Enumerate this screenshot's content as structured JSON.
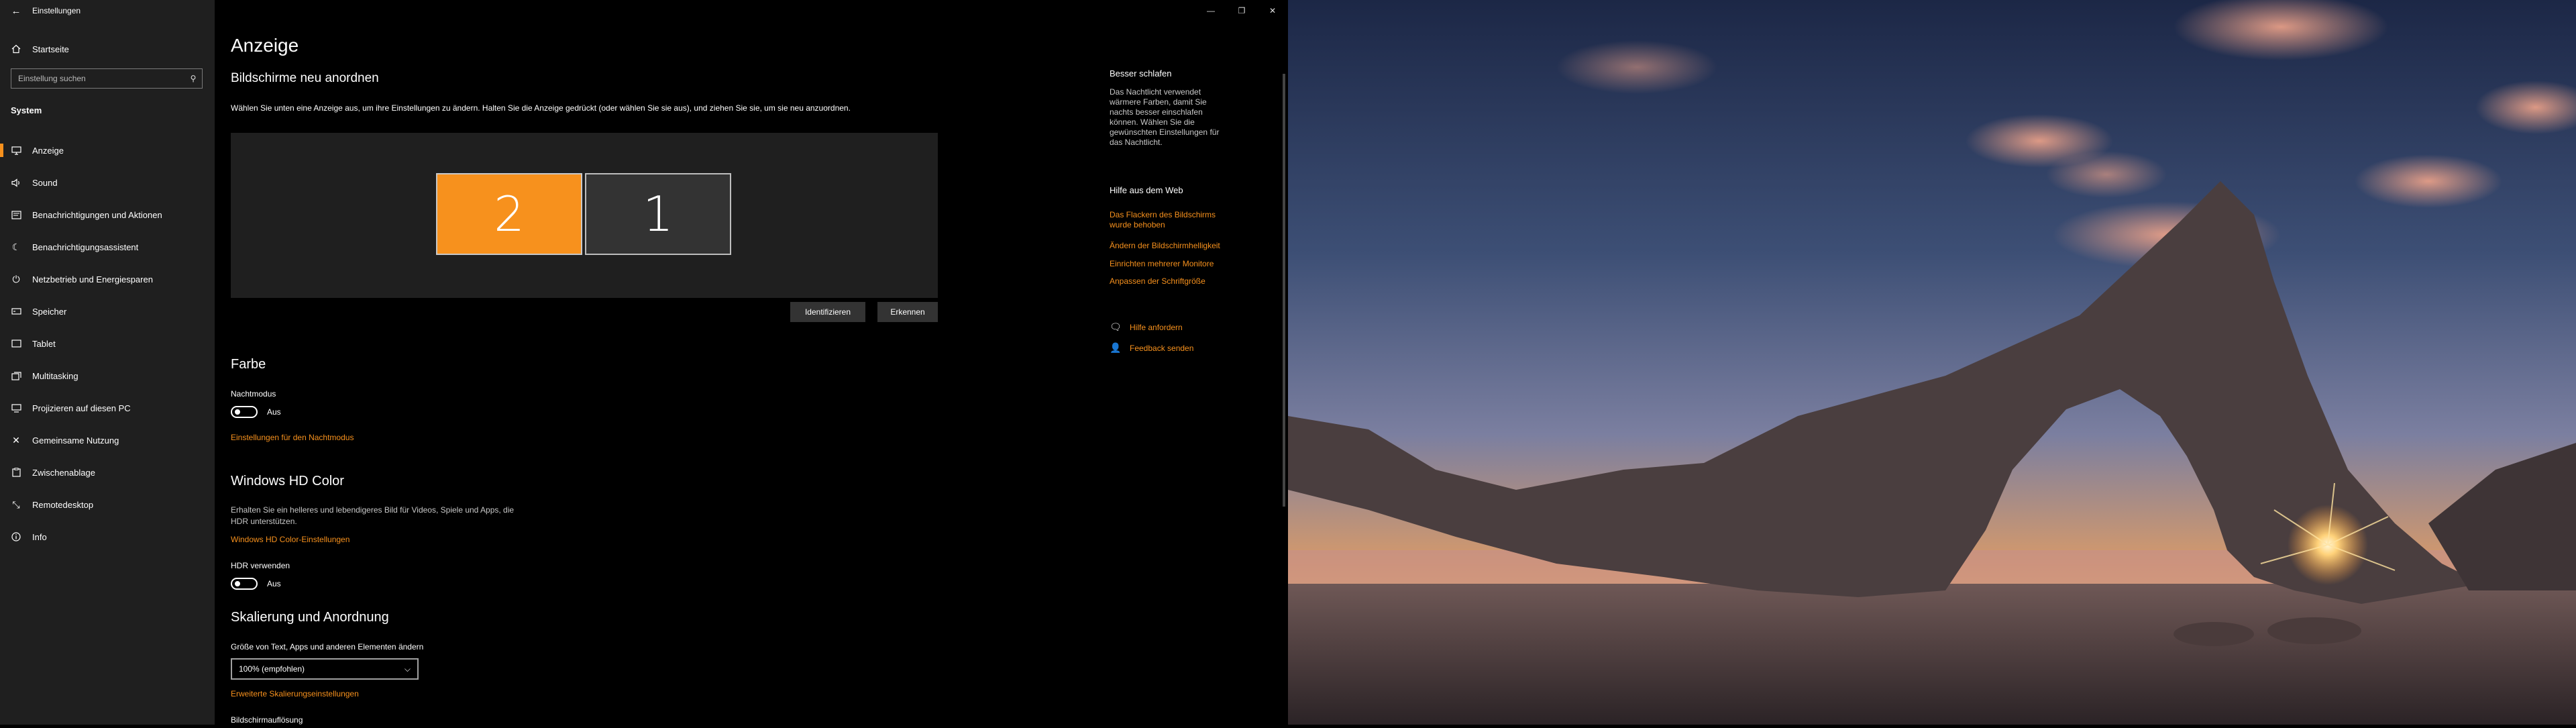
{
  "window": {
    "title": "Einstellungen",
    "controls": {
      "minimize": "—",
      "maximize": "❐",
      "close": "✕"
    }
  },
  "sidebar": {
    "home_label": "Startseite",
    "search_placeholder": "Einstellung suchen",
    "section": "System",
    "items": [
      {
        "label": "Anzeige",
        "icon": "monitor-icon",
        "selected": true
      },
      {
        "label": "Sound",
        "icon": "speaker-icon"
      },
      {
        "label": "Benachrichtigungen und Aktionen",
        "icon": "notification-icon"
      },
      {
        "label": "Benachrichtigungsassistent",
        "icon": "moon-icon"
      },
      {
        "label": "Netzbetrieb und Energiesparen",
        "icon": "power-icon"
      },
      {
        "label": "Speicher",
        "icon": "storage-icon"
      },
      {
        "label": "Tablet",
        "icon": "tablet-icon"
      },
      {
        "label": "Multitasking",
        "icon": "multitasking-icon"
      },
      {
        "label": "Projizieren auf diesen PC",
        "icon": "project-icon"
      },
      {
        "label": "Gemeinsame Nutzung",
        "icon": "share-icon"
      },
      {
        "label": "Zwischenablage",
        "icon": "clipboard-icon"
      },
      {
        "label": "Remotedesktop",
        "icon": "remote-desktop-icon"
      },
      {
        "label": "Info",
        "icon": "info-icon"
      }
    ]
  },
  "main": {
    "title": "Anzeige",
    "arrange": {
      "heading": "Bildschirme neu anordnen",
      "description": "Wählen Sie unten eine Anzeige aus, um ihre Einstellungen zu ändern. Halten Sie die Anzeige gedrückt (oder wählen Sie sie aus), und ziehen Sie sie, um sie neu anzuordnen.",
      "monitors": [
        "2",
        "1"
      ],
      "identify_button": "Identifizieren",
      "detect_button": "Erkennen"
    },
    "color": {
      "heading": "Farbe",
      "night_label": "Nachtmodus",
      "night_state": "Aus",
      "night_link": "Einstellungen für den Nachtmodus"
    },
    "hdr": {
      "heading": "Windows HD Color",
      "description": "Erhalten Sie ein helleres und lebendigeres Bild für Videos, Spiele und Apps, die HDR unterstützen.",
      "link": "Windows HD Color-Einstellungen",
      "toggle_label": "HDR verwenden",
      "toggle_state": "Aus"
    },
    "scale": {
      "heading": "Skalierung und Anordnung",
      "size_label": "Größe von Text, Apps und anderen Elementen ändern",
      "size_value": "100% (empfohlen)",
      "advanced_link": "Erweiterte Skalierungseinstellungen",
      "resolution_label": "Bildschirmauflösung"
    }
  },
  "rail": {
    "sleep_heading": "Besser schlafen",
    "sleep_text": "Das Nachtlicht verwendet wärmere Farben, damit Sie nachts besser einschlafen können. Wählen Sie die gewünschten Einstellungen für das Nachtlicht.",
    "web_heading": "Hilfe aus dem Web",
    "web_links": [
      "Das Flackern des Bildschirms wurde behoben",
      "Ändern der Bildschirmhelligkeit",
      "Einrichten mehrerer Monitore",
      "Anpassen der Schriftgröße"
    ],
    "help_label": "Hilfe anfordern",
    "feedback_label": "Feedback senden"
  },
  "colors": {
    "accent": "#f7911d",
    "sidebar_bg": "#1f1f1f",
    "content_bg": "#000000"
  }
}
